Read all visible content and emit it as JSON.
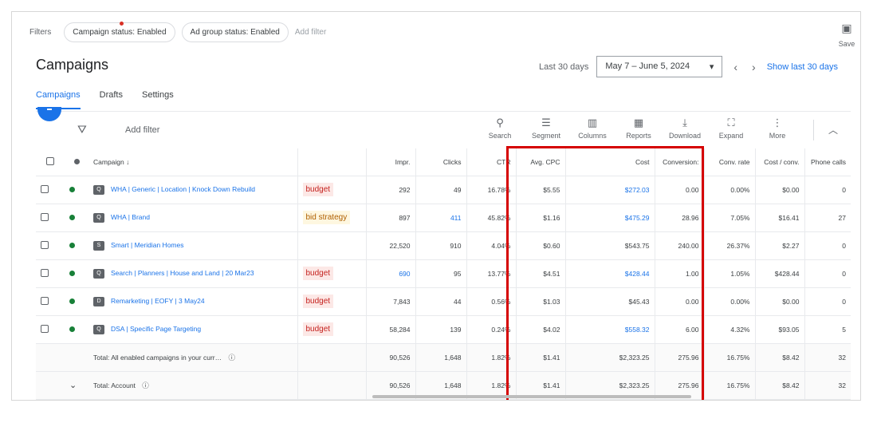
{
  "filters": {
    "label": "Filters",
    "chips": [
      "Campaign status: Enabled",
      "Ad group status: Enabled"
    ],
    "add": "Add filter",
    "save": "Save"
  },
  "title": "Campaigns",
  "date": {
    "label": "Last 30 days",
    "range": "May 7 – June 5, 2024",
    "show_last": "Show last 30 days"
  },
  "tabs": [
    "Campaigns",
    "Drafts",
    "Settings"
  ],
  "toolbar": {
    "add_filter": "Add filter",
    "tools": [
      {
        "icon": "search-icon",
        "glyph": "⚲",
        "label": "Search"
      },
      {
        "icon": "segment-icon",
        "glyph": "☰",
        "label": "Segment"
      },
      {
        "icon": "columns-icon",
        "glyph": "▥",
        "label": "Columns"
      },
      {
        "icon": "reports-icon",
        "glyph": "▦",
        "label": "Reports"
      },
      {
        "icon": "download-icon",
        "glyph": "⤓",
        "label": "Download"
      },
      {
        "icon": "expand-icon",
        "glyph": "⛶",
        "label": "Expand"
      },
      {
        "icon": "more-icon",
        "glyph": "⋮",
        "label": "More"
      }
    ]
  },
  "columns": {
    "campaign": "Campaign ↓",
    "impr": "Impr.",
    "clicks": "Clicks",
    "ctr": "CTR",
    "avg_cpc": "Avg. CPC",
    "cost": "Cost",
    "conversions": "Conversion:",
    "conv_rate": "Conv. rate",
    "cost_conv": "Cost / conv.",
    "phone_calls": "Phone calls"
  },
  "rows": [
    {
      "campaign": "WHA | Generic | Location | Knock Down Rebuild",
      "status": "budget",
      "status_type": "red",
      "impr": "292",
      "clicks": "49",
      "clicks_link": false,
      "ctr": "16.78%",
      "avg_cpc": "$5.55",
      "cost": "$272.03",
      "cost_link": true,
      "conversions": "0.00",
      "conv_rate": "0.00%",
      "cost_conv": "$0.00",
      "phone_calls": "0",
      "icon": "Q"
    },
    {
      "campaign": "WHA | Brand",
      "status": "bid strategy",
      "status_type": "yellow",
      "impr": "897",
      "clicks": "411",
      "clicks_link": true,
      "ctr": "45.82%",
      "avg_cpc": "$1.16",
      "cost": "$475.29",
      "cost_link": true,
      "conversions": "28.96",
      "conv_rate": "7.05%",
      "cost_conv": "$16.41",
      "phone_calls": "27",
      "icon": "Q"
    },
    {
      "campaign": "Smart | Meridian Homes",
      "status": "",
      "status_type": "",
      "impr": "22,520",
      "clicks": "910",
      "clicks_link": false,
      "ctr": "4.04%",
      "avg_cpc": "$0.60",
      "cost": "$543.75",
      "cost_link": false,
      "conversions": "240.00",
      "conv_rate": "26.37%",
      "cost_conv": "$2.27",
      "phone_calls": "0",
      "icon": "S"
    },
    {
      "campaign": "Search | Planners | House and Land | 20 Mar23",
      "status": "budget",
      "status_type": "red",
      "impr": "690",
      "clicks": "95",
      "clicks_link": false,
      "ctr": "13.77%",
      "avg_cpc": "$4.51",
      "cost": "$428.44",
      "cost_link": true,
      "conversions": "1.00",
      "conv_rate": "1.05%",
      "cost_conv": "$428.44",
      "phone_calls": "0",
      "icon": "Q",
      "impr_link": true
    },
    {
      "campaign": "Remarketing | EOFY | 3 May24",
      "status": "budget",
      "status_type": "red",
      "impr": "7,843",
      "clicks": "44",
      "clicks_link": false,
      "ctr": "0.56%",
      "avg_cpc": "$1.03",
      "cost": "$45.43",
      "cost_link": false,
      "conversions": "0.00",
      "conv_rate": "0.00%",
      "cost_conv": "$0.00",
      "phone_calls": "0",
      "icon": "D"
    },
    {
      "campaign": "DSA | Specific Page Targeting",
      "status": "budget",
      "status_type": "red",
      "impr": "58,284",
      "clicks": "139",
      "clicks_link": false,
      "ctr": "0.24%",
      "avg_cpc": "$4.02",
      "cost": "$558.32",
      "cost_link": true,
      "conversions": "6.00",
      "conv_rate": "4.32%",
      "cost_conv": "$93.05",
      "phone_calls": "5",
      "icon": "Q"
    }
  ],
  "totals": [
    {
      "label": "Total: All enabled campaigns in your curr…",
      "impr": "90,526",
      "clicks": "1,648",
      "ctr": "1.82%",
      "avg_cpc": "$1.41",
      "cost": "$2,323.25",
      "conversions": "275.96",
      "conv_rate": "16.75%",
      "cost_conv": "$8.42",
      "phone_calls": "32"
    },
    {
      "label": "Total: Account",
      "impr": "90,526",
      "clicks": "1,648",
      "ctr": "1.82%",
      "avg_cpc": "$1.41",
      "cost": "$2,323.25",
      "conversions": "275.96",
      "conv_rate": "16.75%",
      "cost_conv": "$8.42",
      "phone_calls": "32"
    }
  ],
  "colors": {
    "accent": "#1a73e8",
    "highlight": "#d50000",
    "enabled": "#188038"
  }
}
